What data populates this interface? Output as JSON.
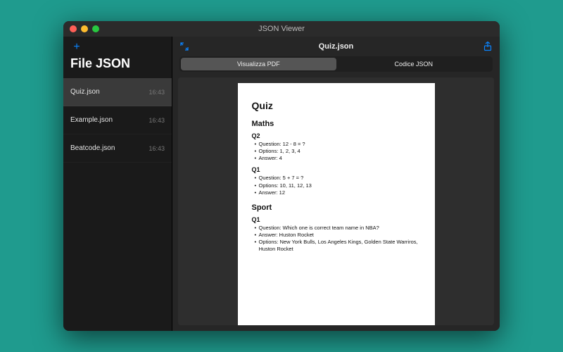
{
  "window": {
    "title": "JSON Viewer"
  },
  "sidebar": {
    "title": "File JSON",
    "add_label": "+",
    "files": [
      {
        "name": "Quiz.json",
        "time": "16:43",
        "active": true
      },
      {
        "name": "Example.json",
        "time": "16:43",
        "active": false
      },
      {
        "name": "Beatcode.json",
        "time": "16:43",
        "active": false
      }
    ]
  },
  "main": {
    "current_file": "Quiz.json",
    "tabs": [
      {
        "label": "Visualizza PDF",
        "active": true
      },
      {
        "label": "Codice JSON",
        "active": false
      }
    ]
  },
  "document": {
    "title": "Quiz",
    "sections": [
      {
        "heading": "Maths",
        "questions": [
          {
            "id": "Q2",
            "lines": [
              "Question: 12 - 8 = ?",
              "Options: 1, 2, 3, 4",
              "Answer: 4"
            ]
          },
          {
            "id": "Q1",
            "lines": [
              "Question: 5 + 7 = ?",
              "Options: 10, 11, 12, 13",
              "Answer: 12"
            ]
          }
        ]
      },
      {
        "heading": "Sport",
        "questions": [
          {
            "id": "Q1",
            "lines": [
              "Question: Which one is correct team name in NBA?",
              "Answer: Huston Rocket",
              "Options: New York Bulls, Los Angeles Kings, Golden State Warriros, Huston Rocket"
            ]
          }
        ]
      }
    ]
  }
}
